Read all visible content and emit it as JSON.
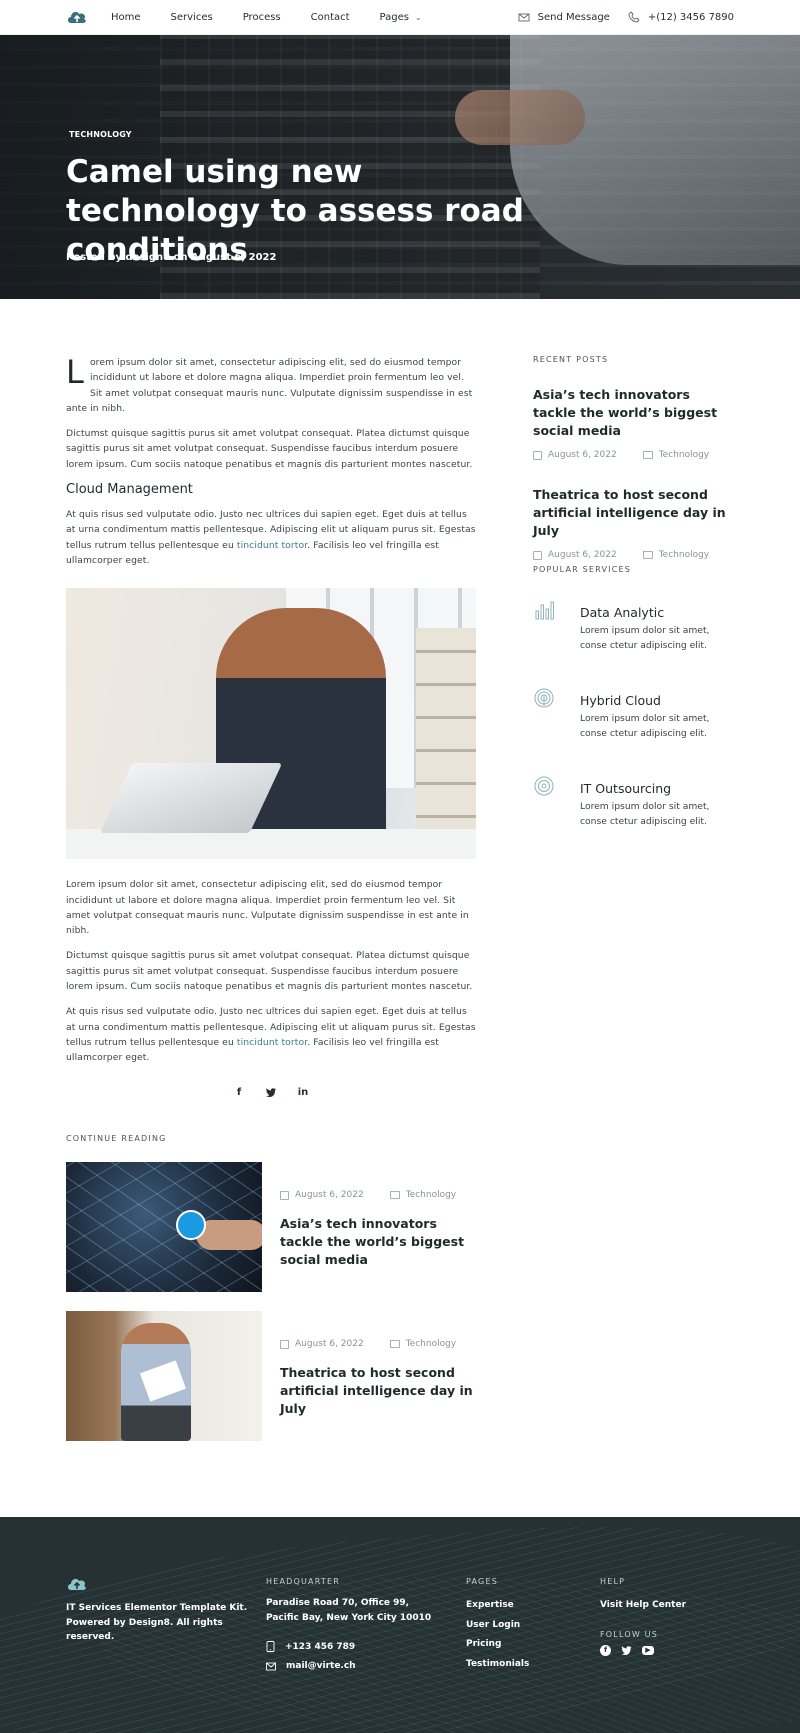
{
  "header": {
    "nav": [
      {
        "label": "Home"
      },
      {
        "label": "Services"
      },
      {
        "label": "Process"
      },
      {
        "label": "Contact"
      },
      {
        "label": "Pages"
      }
    ],
    "send_message": "Send Message",
    "phone": "+(12) 3456 7890"
  },
  "hero": {
    "tag": "TECHNOLOGY",
    "title": "Camel using new technology to assess road conditions",
    "meta": "Posted by design8 on August 6, 2022"
  },
  "article": {
    "p1_dropcap": "L",
    "p1": "orem ipsum dolor sit amet, consectetur adipiscing elit, sed do eiusmod tempor incididunt ut labore et dolore magna aliqua. Imperdiet proin fermentum leo vel. Sit amet volutpat consequat mauris nunc. Vulputate dignissim suspendisse in est ante in nibh.",
    "p2": "Dictumst quisque sagittis purus sit amet volutpat consequat. Platea dictumst quisque sagittis purus sit amet volutpat consequat. Suspendisse faucibus interdum posuere lorem ipsum. Cum sociis natoque penatibus et magnis dis parturient montes nascetur.",
    "subheading": "Cloud Management",
    "p3_a": "At quis risus sed vulputate odio. Justo nec ultrices dui sapien eget. Eget duis at tellus at urna condimentum mattis pellentesque. Adipiscing elit ut aliquam purus sit. Egestas tellus rutrum tellus pellentesque eu ",
    "p3_link": "tincidunt tortor",
    "p3_b": ". Facilisis leo vel fringilla est ullamcorper eget.",
    "p4": "Lorem ipsum dolor sit amet, consectetur adipiscing elit, sed do eiusmod tempor incididunt ut labore et dolore magna aliqua. Imperdiet proin fermentum leo vel. Sit amet volutpat consequat mauris nunc. Vulputate dignissim suspendisse in est ante in nibh.",
    "p5": "Dictumst quisque sagittis purus sit amet volutpat consequat. Platea dictumst quisque sagittis purus sit amet volutpat consequat. Suspendisse faucibus interdum posuere lorem ipsum. Cum sociis natoque penatibus et magnis dis parturient montes nascetur.",
    "p6_a": "At quis risus sed vulputate odio. Justo nec ultrices dui sapien eget. Eget duis at tellus at urna condimentum mattis pellentesque. Adipiscing elit ut aliquam purus sit. Egestas tellus rutrum tellus pellentesque eu ",
    "p6_link": "tincidunt tortor",
    "p6_b": ". Facilisis leo vel fringilla est ullamcorper eget.",
    "share": [
      "f",
      "t",
      "in"
    ]
  },
  "continue_reading": {
    "heading": "CONTINUE READING",
    "posts": [
      {
        "date": "August 6, 2022",
        "category": "Technology",
        "title": "Asia’s tech innovators tackle the world’s biggest social media"
      },
      {
        "date": "August 6, 2022",
        "category": "Technology",
        "title": "Theatrica to host second artificial intelligence day in July"
      }
    ]
  },
  "sidebar": {
    "recent_heading": "RECENT POSTS",
    "recent": [
      {
        "title": "Asia’s tech innovators tackle the world’s biggest social media",
        "date": "August 6, 2022",
        "category": "Technology"
      },
      {
        "title": "Theatrica to host second artificial intelligence day in July",
        "date": "August 6, 2022",
        "category": "Technology"
      }
    ],
    "popular_heading": "POPULAR SERVICES",
    "services": [
      {
        "title": "Data Analytic",
        "desc": "Lorem ipsum dolor sit amet, conse ctetur adipiscing elit.",
        "icon": "bar-chart-icon"
      },
      {
        "title": "Hybrid Cloud",
        "desc": "Lorem ipsum dolor sit amet, conse ctetur adipiscing elit.",
        "icon": "fingerprint-icon"
      },
      {
        "title": "IT Outsourcing",
        "desc": "Lorem ipsum dolor sit amet, conse ctetur adipiscing elit.",
        "icon": "target-icon"
      }
    ]
  },
  "footer": {
    "about_l1": "IT Services Elementor Template Kit.",
    "about_l2": "Powered by Design8. All rights",
    "about_l3": "reserved.",
    "hq_heading": "HEADQUARTER",
    "hq_l1": "Paradise Road 70, Office 99,",
    "hq_l2": "Pacific Bay,  New York City 10010",
    "phone": "+123 456 789",
    "email": "mail@virte.ch",
    "pages_heading": "PAGES",
    "pages": [
      {
        "label": "Expertise"
      },
      {
        "label": "User Login"
      },
      {
        "label": "Pricing"
      },
      {
        "label": "Testimonials"
      }
    ],
    "help_heading": "HELP",
    "help_link": "Visit Help Center",
    "follow_heading": "FOLLOW US"
  },
  "colors": {
    "accent": "#3b7c8c",
    "footer_bg": "#263134",
    "text": "#1e2a2c"
  }
}
